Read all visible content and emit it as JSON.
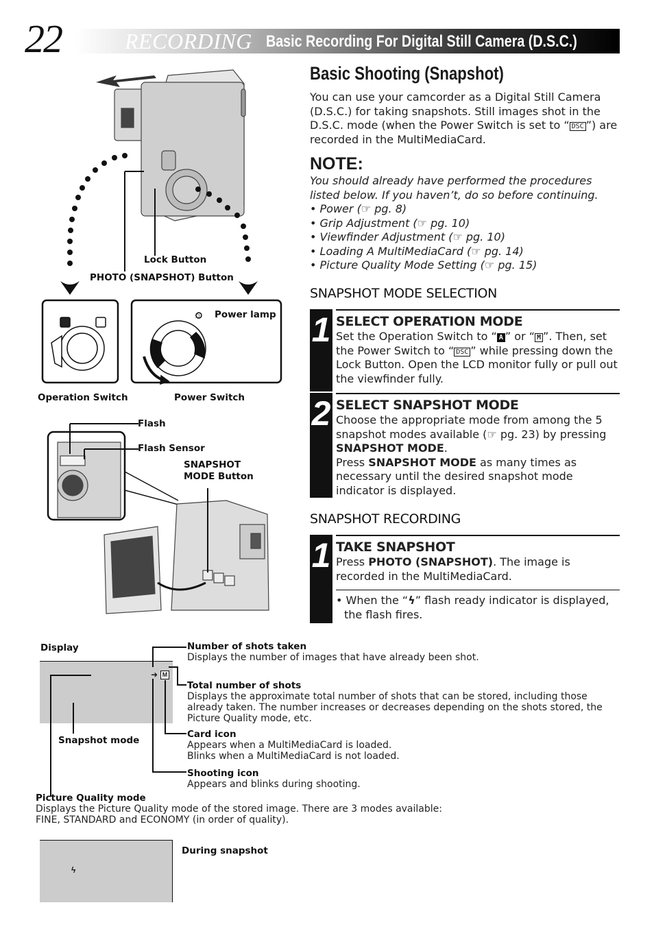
{
  "header": {
    "page_number": "22",
    "section": "RECORDING",
    "subtitle": "Basic Recording For Digital Still Camera (D.S.C.)"
  },
  "main": {
    "title": "Basic Shooting (Snapshot)",
    "intro_part1": "You can use your camcorder as a Digital Still Camera (D.S.C.) for taking snapshots. Still images shot in the D.S.C. mode (when the Power Switch is set to “",
    "intro_icon": "DSC",
    "intro_part2": "”) are recorded in the MultiMediaCard.",
    "note": {
      "heading": "NOTE:",
      "text": "You should already have performed the procedures listed below. If you haven’t, do so before continuing.",
      "items": [
        "Power (☞ pg. 8)",
        "Grip Adjustment (☞ pg. 10)",
        "Viewfinder Adjustment (☞ pg. 10)",
        "Loading A MultiMediaCard (☞ pg. 14)",
        "Picture Quality Mode Setting (☞ pg. 15)"
      ]
    },
    "mode_selection": {
      "heading": "SNAPSHOT MODE SELECTION",
      "steps": [
        {
          "number": "1",
          "title": "SELECT OPERATION MODE",
          "t1": "Set the Operation Switch to “",
          "icon_a": "A",
          "t2": "” or “",
          "icon_m": "M",
          "t3": "”. Then, set the Power Switch to “",
          "icon_dsc": "DSC",
          "t4": "” while pressing down the Lock Button. Open the LCD monitor fully or pull out the viewfinder fully."
        },
        {
          "number": "2",
          "title": "SELECT SNAPSHOT MODE",
          "t1": "Choose the appropriate mode from among the 5 snapshot modes available (☞ pg. 23) by pressing ",
          "b1": "SNAPSHOT MODE",
          "t2": ".",
          "t3": "Press ",
          "b2": "SNAPSHOT MODE",
          "t4": " as many times as necessary until the desired snapshot mode indicator is displayed."
        }
      ]
    },
    "recording": {
      "heading": "SNAPSHOT RECORDING",
      "step": {
        "number": "1",
        "title": "TAKE SNAPSHOT",
        "t1": "Press ",
        "b1": "PHOTO (SNAPSHOT)",
        "t2": ". The image is recorded in the MultiMediaCard.",
        "bullet_a": "When the “",
        "flash_icon": "ϟ",
        "bullet_b": "” flash ready indicator is displayed, the flash fires."
      }
    }
  },
  "figure_labels": {
    "lock_button": "Lock Button",
    "photo_button": "PHOTO (SNAPSHOT) Button",
    "power_lamp": "Power lamp",
    "operation_switch": "Operation Switch",
    "power_switch": "Power Switch",
    "flash": "Flash",
    "flash_sensor": "Flash Sensor",
    "snapshot_mode_button_1": "SNAPSHOT",
    "snapshot_mode_button_2": "MODE Button"
  },
  "display_diagram": {
    "label": "Display",
    "snapshot_mode": "Snapshot mode",
    "card_icon_glyph": "M",
    "callouts": [
      {
        "title": "Number of shots taken",
        "text": "Displays the number of images that have already been shot."
      },
      {
        "title": "Total number of shots",
        "text": "Displays the approximate total number of shots that can be stored, including those already taken. The number increases or decreases depending on the shots stored, the Picture Quality mode, etc."
      },
      {
        "title": "Card icon",
        "text": "Appears when a MultiMediaCard is loaded.",
        "text2": "Blinks when a MultiMediaCard is not loaded."
      },
      {
        "title": "Shooting icon",
        "text": "Appears and blinks during shooting."
      },
      {
        "title": "Picture Quality mode",
        "text": "Displays the Picture Quality mode of the stored image. There are 3 modes available:",
        "text2": "FINE, STANDARD and ECONOMY (in order of quality)."
      }
    ],
    "during_label": "During snapshot",
    "during_flash_glyph": "ϟ"
  },
  "colors": {
    "lcd_gray": "#cccccc",
    "ink": "#111111"
  }
}
